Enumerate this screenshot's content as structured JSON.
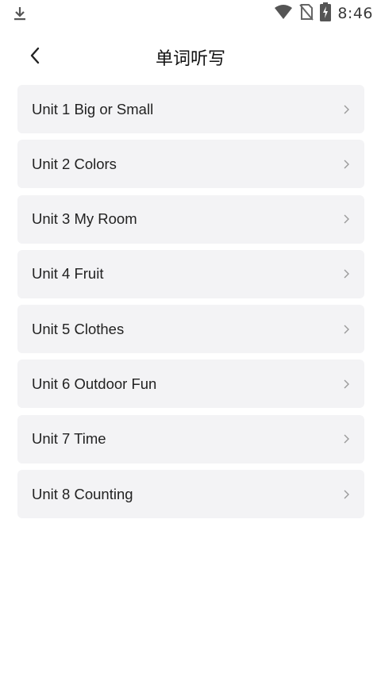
{
  "status_bar": {
    "time": "8:46",
    "icons": [
      "download-icon",
      "wifi-icon",
      "no-sim-icon",
      "battery-charging-icon"
    ]
  },
  "header": {
    "title": "单词听写",
    "back_icon": "back-chevron-icon"
  },
  "units": [
    {
      "label": "Unit 1 Big or Small"
    },
    {
      "label": "Unit 2 Colors"
    },
    {
      "label": "Unit 3 My Room"
    },
    {
      "label": "Unit 4 Fruit"
    },
    {
      "label": "Unit 5 Clothes"
    },
    {
      "label": "Unit 6 Outdoor Fun"
    },
    {
      "label": "Unit 7 Time"
    },
    {
      "label": "Unit 8 Counting"
    }
  ],
  "colors": {
    "card_bg": "#f3f3f5",
    "text": "#222222",
    "chevron": "#9a9a9a"
  }
}
